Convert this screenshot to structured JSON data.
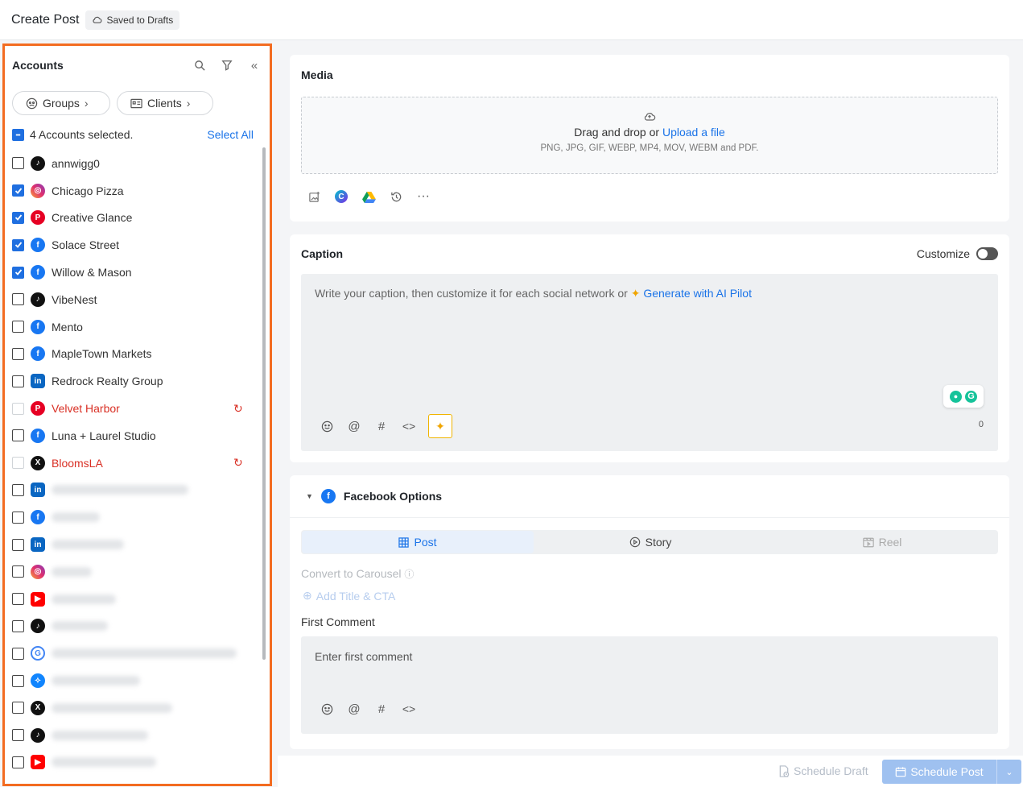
{
  "header": {
    "title": "Create Post",
    "draft_badge": "Saved to Drafts"
  },
  "accounts": {
    "title": "Accounts",
    "groups_label": "Groups",
    "clients_label": "Clients",
    "selected_text": "4 Accounts selected.",
    "select_all": "Select All",
    "items": [
      {
        "name": "annwigg0",
        "network": "tiktok",
        "checked": false,
        "warn": false
      },
      {
        "name": "Chicago Pizza",
        "network": "instagram",
        "checked": true,
        "warn": false
      },
      {
        "name": "Creative Glance",
        "network": "pinterest",
        "checked": true,
        "warn": false
      },
      {
        "name": "Solace Street",
        "network": "facebook",
        "checked": true,
        "warn": false
      },
      {
        "name": "Willow & Mason",
        "network": "facebook",
        "checked": true,
        "warn": false
      },
      {
        "name": "VibeNest",
        "network": "tiktok",
        "checked": false,
        "warn": false
      },
      {
        "name": "Mento",
        "network": "facebook",
        "checked": false,
        "warn": false
      },
      {
        "name": "MapleTown Markets",
        "network": "facebook",
        "checked": false,
        "warn": false
      },
      {
        "name": "Redrock Realty Group",
        "network": "linkedin",
        "checked": false,
        "warn": false
      },
      {
        "name": "Velvet Harbor",
        "network": "pinterest",
        "checked": false,
        "warn": true
      },
      {
        "name": "Luna + Laurel Studio",
        "network": "facebook",
        "checked": false,
        "warn": false
      },
      {
        "name": "BloomsLA",
        "network": "x",
        "checked": false,
        "warn": true
      },
      {
        "name": "",
        "network": "linkedin",
        "checked": false,
        "warn": false
      },
      {
        "name": "",
        "network": "facebook",
        "checked": false,
        "warn": false
      },
      {
        "name": "",
        "network": "linkedin",
        "checked": false,
        "warn": false
      },
      {
        "name": "",
        "network": "instagram",
        "checked": false,
        "warn": false
      },
      {
        "name": "",
        "network": "youtube",
        "checked": false,
        "warn": false
      },
      {
        "name": "",
        "network": "tiktok",
        "checked": false,
        "warn": false
      },
      {
        "name": "",
        "network": "google",
        "checked": false,
        "warn": false
      },
      {
        "name": "",
        "network": "bluesky",
        "checked": false,
        "warn": false
      },
      {
        "name": "",
        "network": "x",
        "checked": false,
        "warn": false
      },
      {
        "name": "",
        "network": "tiktok",
        "checked": false,
        "warn": false
      },
      {
        "name": "",
        "network": "youtube",
        "checked": false,
        "warn": false
      }
    ]
  },
  "media": {
    "title": "Media",
    "drop_text": "Drag and drop or",
    "upload_link": "Upload a file",
    "formats": "PNG, JPG, GIF, WEBP, MP4, MOV, WEBM and PDF."
  },
  "caption": {
    "title": "Caption",
    "customize_label": "Customize",
    "placeholder": "Write your caption, then customize it for each social network or",
    "ai_link": "Generate with AI Pilot",
    "char_count": "0"
  },
  "facebook": {
    "title": "Facebook Options",
    "tabs": [
      "Post",
      "Story",
      "Reel"
    ],
    "convert_label": "Convert to Carousel",
    "add_title": "Add Title & CTA",
    "first_comment_label": "First Comment",
    "first_comment_placeholder": "Enter first comment"
  },
  "footer": {
    "schedule_draft": "Schedule Draft",
    "schedule_post": "Schedule Post"
  },
  "colors": {
    "accent": "#1a73e8",
    "panel_border": "#f36c21",
    "warn": "#d93025"
  }
}
